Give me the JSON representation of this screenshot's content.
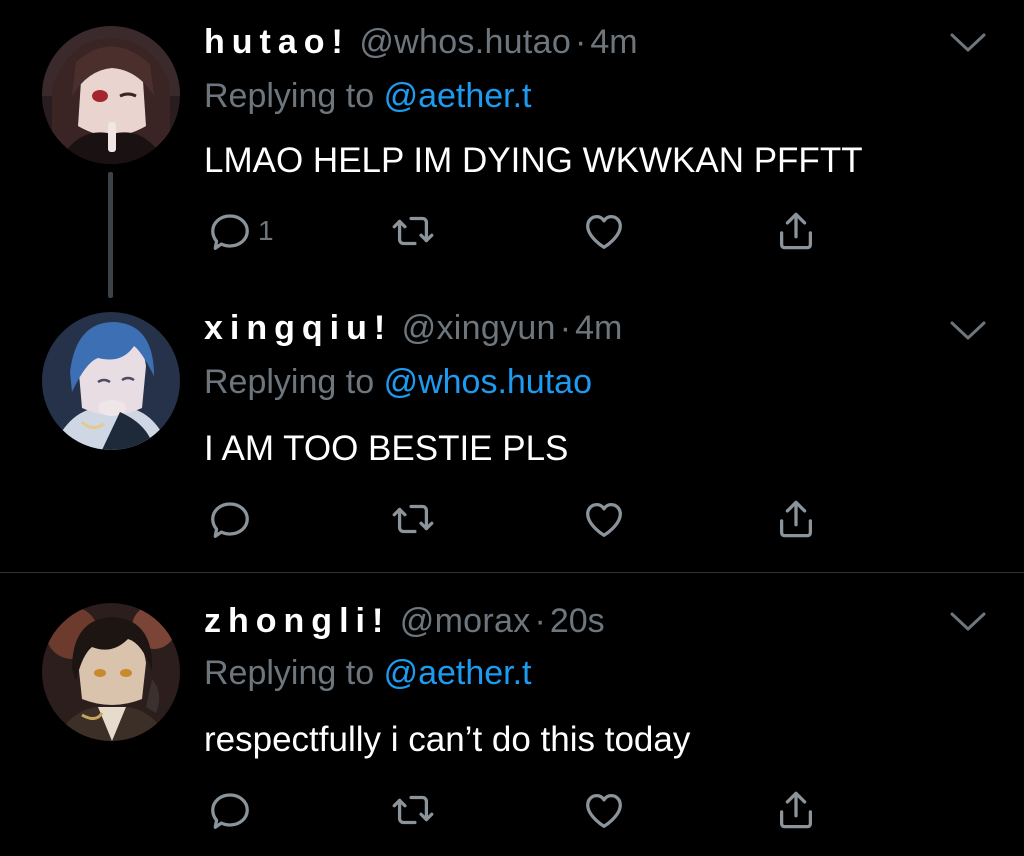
{
  "tweets": [
    {
      "display_name": "hutao!",
      "handle": "@whos.hutao",
      "dot": "·",
      "time": "4m",
      "replying_prefix": "Replying to",
      "replying_to": "@aether.t",
      "text": "LMAO HELP IM DYING WKWKAN PFFTT",
      "reply_count": "1",
      "avatar": "hutao-avatar"
    },
    {
      "display_name": "xingqiu!",
      "handle": "@xingyun",
      "dot": "·",
      "time": "4m",
      "replying_prefix": "Replying to",
      "replying_to": "@whos.hutao",
      "text": "I AM TOO BESTIE PLS",
      "reply_count": "",
      "avatar": "xingqiu-avatar"
    },
    {
      "display_name": "zhongli!",
      "handle": "@morax",
      "dot": "·",
      "time": "20s",
      "replying_prefix": "Replying to",
      "replying_to": "@aether.t",
      "text": "respectfully i can’t do this today",
      "reply_count": "",
      "avatar": "zhongli-avatar"
    }
  ],
  "icons": {
    "reply": "reply-icon",
    "retweet": "retweet-icon",
    "like": "heart-icon",
    "share": "share-icon",
    "more": "chevron-down-icon"
  },
  "colors": {
    "background": "#000000",
    "text": "#ffffff",
    "muted": "#6e767d",
    "link": "#1d9bf0",
    "divider": "#2f3336"
  }
}
